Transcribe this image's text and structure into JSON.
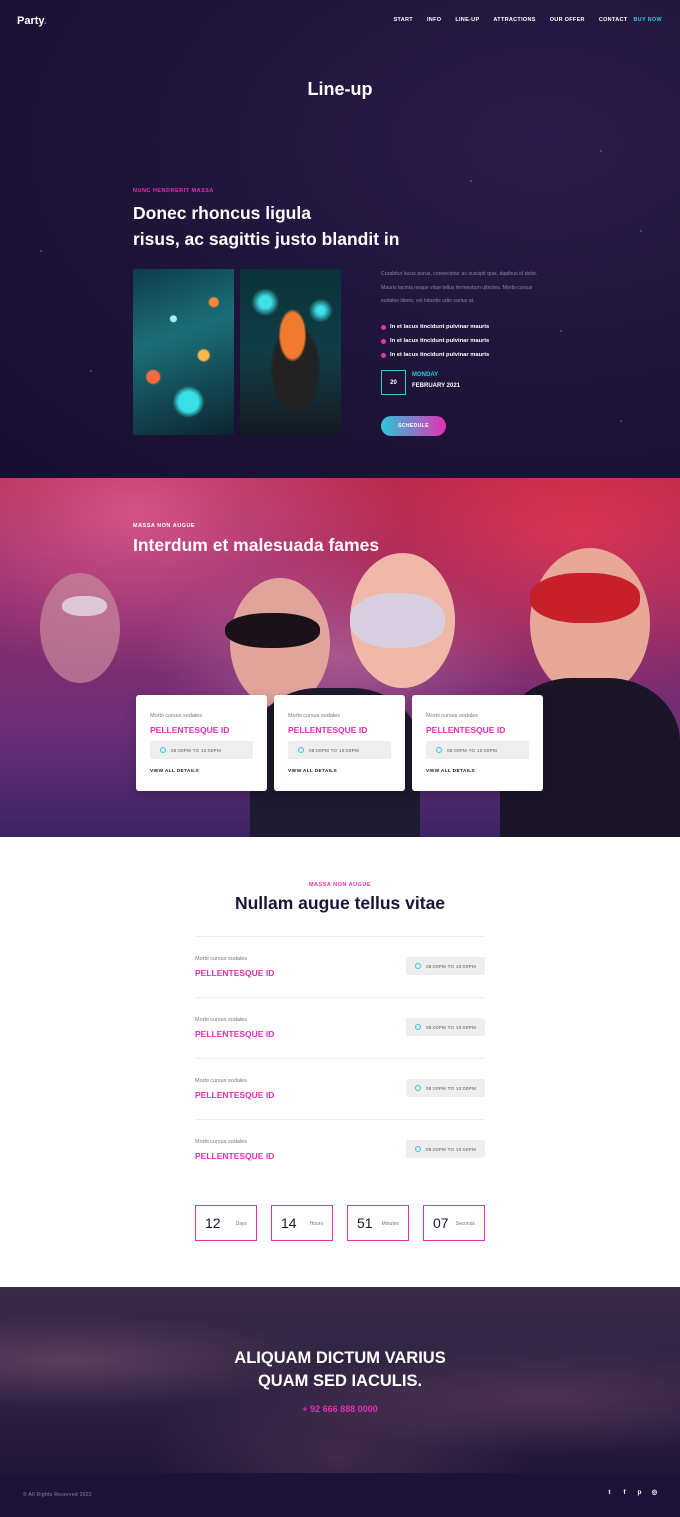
{
  "header": {
    "logo": "Party",
    "logo_dot": ".",
    "nav": [
      "START",
      "INFO",
      "LINE-UP",
      "ATTRACTIONS",
      "OUR OFFER",
      "CONTACT"
    ],
    "buy_now": "BUY NOW"
  },
  "hero": {
    "title": "Line-up",
    "eyebrow": "NUNC HENDRERIT MASSA",
    "heading_line1": "Donec rhoncus ligula",
    "heading_line2": "risus, ac sagittis justo blandit in",
    "paragraph": "Curabitur lacus purus, consectetur ac suscipit quis, dapibus id dolor. Mauris lacinia neque vitae tellus fermentum ultricies. Morbi cursus sodales libero, vel lobortis odio varius at.",
    "bullets": [
      "In et lacus tincidunt pulvinar mauris",
      "In et lacus tincidunt pulvinar mauris",
      "In et lacus tincidunt pulvinar mauris"
    ],
    "date_number": "20",
    "date_day": "MONDAY",
    "date_month": "FEBRUARY 2021",
    "button": "SCHEDULE"
  },
  "party": {
    "eyebrow": "MASSA NON AUGUE",
    "heading": "Interdum et malesuada fames",
    "cards": [
      {
        "small": "Morbi cursus sodales",
        "title": "PELLENTESQUE ID",
        "time": "08:00PM TO 10:00PM",
        "link": "VIEW ALL DETAILS"
      },
      {
        "small": "Morbi cursus sodales",
        "title": "PELLENTESQUE ID",
        "time": "08:00PM TO 10:00PM",
        "link": "VIEW ALL DETAILS"
      },
      {
        "small": "Morbi cursus sodales",
        "title": "PELLENTESQUE ID",
        "time": "08:00PM TO 10:00PM",
        "link": "VIEW ALL DETAILS"
      }
    ]
  },
  "schedule": {
    "eyebrow": "MASSA NON AUGUE",
    "heading": "Nullam augue tellus vitae",
    "rows": [
      {
        "small": "Morbi cursus sodales",
        "title": "PELLENTESQUE ID",
        "time": "08:00PM TO 10:00PM"
      },
      {
        "small": "Morbi cursus sodales",
        "title": "PELLENTESQUE ID",
        "time": "08:00PM TO 10:00PM"
      },
      {
        "small": "Morbi cursus sodales",
        "title": "PELLENTESQUE ID",
        "time": "08:00PM TO 10:00PM"
      },
      {
        "small": "Morbi cursus sodales",
        "title": "PELLENTESQUE ID",
        "time": "08:00PM TO 10:00PM"
      }
    ],
    "countdown": [
      {
        "value": "12",
        "label": "Days"
      },
      {
        "value": "14",
        "label": "Hours"
      },
      {
        "value": "51",
        "label": "Minutes"
      },
      {
        "value": "07",
        "label": "Seconds"
      }
    ]
  },
  "cta": {
    "line1": "ALIQUAM DICTUM VARIUS",
    "line2": "QUAM SED IACULIS.",
    "phone": "+ 92 666 888 0000"
  },
  "footer": {
    "copyright": "© All Rights Reserved 2022",
    "socials": [
      "twitter-icon",
      "facebook-icon",
      "pinterest-icon",
      "instagram-icon"
    ]
  },
  "colors": {
    "accent_pink": "#e52fb5",
    "accent_cyan": "#29c8d8",
    "dark_bg": "#1c1338"
  }
}
